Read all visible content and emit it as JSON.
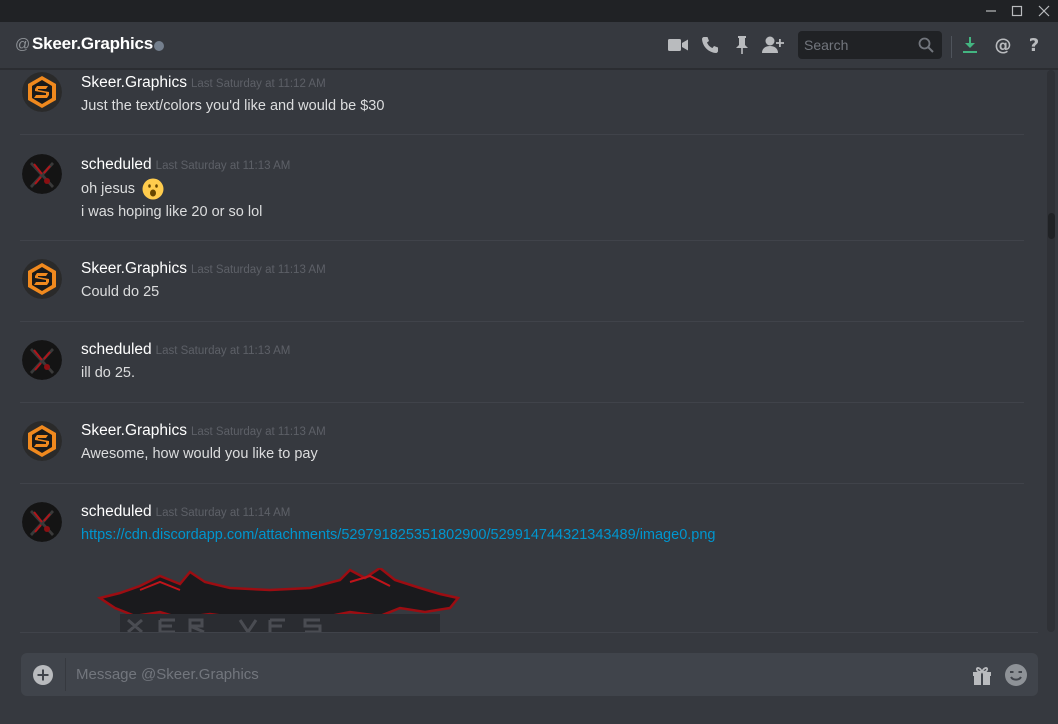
{
  "header": {
    "at_symbol": "@",
    "channel_name": "Skeer.Graphics",
    "search_placeholder": "Search"
  },
  "messages": [
    {
      "author": "Skeer.Graphics",
      "author_color": "#ffffff",
      "avatar": "skeer-logo",
      "timestamp": "Last Saturday at 11:12 AM",
      "lines": [
        "Just the text/colors you'd like and would be $30"
      ]
    },
    {
      "author": "scheduled",
      "author_color": "#ffffff",
      "avatar": "red-x-logo",
      "timestamp": "Last Saturday at 11:13 AM",
      "lines": [
        "oh jesus",
        "i was hoping like 20 or so lol"
      ],
      "emoji": "open-mouth-emoji"
    },
    {
      "author": "Skeer.Graphics",
      "author_color": "#ffffff",
      "avatar": "skeer-logo",
      "timestamp": "Last Saturday at 11:13 AM",
      "lines": [
        "Could do 25"
      ]
    },
    {
      "author": "scheduled",
      "author_color": "#ffffff",
      "avatar": "red-x-logo",
      "timestamp": "Last Saturday at 11:13 AM",
      "lines": [
        "ill do 25."
      ]
    },
    {
      "author": "Skeer.Graphics",
      "author_color": "#ffffff",
      "avatar": "skeer-logo",
      "timestamp": "Last Saturday at 11:13 AM",
      "lines": [
        "Awesome, how would you like to pay"
      ]
    },
    {
      "author": "scheduled",
      "author_color": "#ffffff",
      "avatar": "red-x-logo",
      "timestamp": "Last Saturday at 11:14 AM",
      "lines": [
        "https://cdn.discordapp.com/attachments/529791825351802900/529914744321343489/image0.png"
      ],
      "attachment": "image-embed-preview"
    }
  ],
  "composer": {
    "placeholder": "Message @Skeer.Graphics"
  },
  "colors": {
    "background": "#36393f",
    "titlebar": "#202225",
    "link": "#0096cf",
    "download_icon": "#43b581",
    "skeer_orange": "#f0891e"
  },
  "icons": [
    "video-call-icon",
    "voice-call-icon",
    "pin-icon",
    "add-friend-icon",
    "search-icon",
    "download-icon",
    "mention-icon",
    "help-icon",
    "upload-icon",
    "gift-icon",
    "emoji-picker-icon"
  ]
}
